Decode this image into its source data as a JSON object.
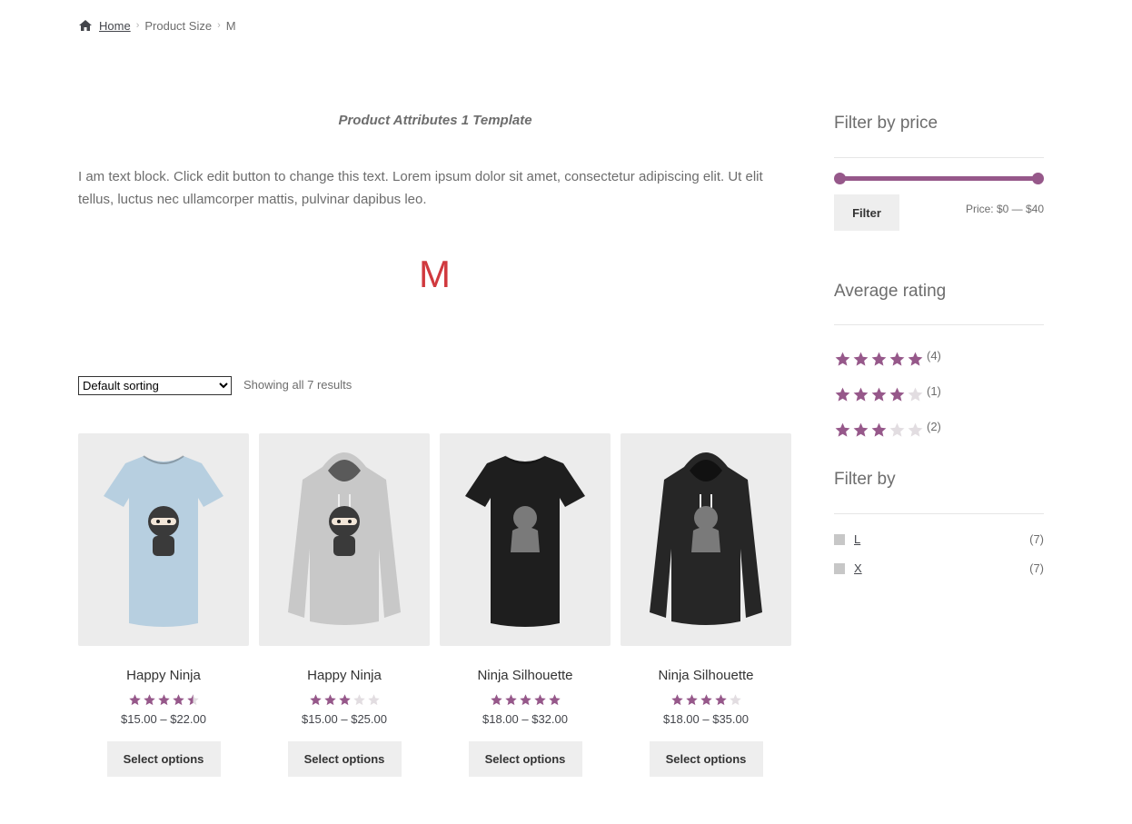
{
  "breadcrumb": {
    "home": "Home",
    "separator": "›",
    "level1": "Product Size",
    "level2": "M"
  },
  "template_title": "Product Attributes 1 Template",
  "text_block": "I am text block. Click edit button to change this text. Lorem ipsum dolor sit amet, consectetur adipiscing elit. Ut elit tellus, luctus nec ullamcorper mattis, pulvinar dapibus leo.",
  "size_heading": "M",
  "ordering": {
    "selected": "Default sorting"
  },
  "result_count": "Showing all 7 results",
  "products": [
    {
      "title": "Happy Ninja",
      "rating": 4.5,
      "price": "$15.00 – $22.00",
      "button": "Select options",
      "garment": "tshirt",
      "color": "#b7cfe0",
      "figure": "ninja"
    },
    {
      "title": "Happy Ninja",
      "rating": 3,
      "price": "$15.00 – $25.00",
      "button": "Select options",
      "garment": "hoodie",
      "color": "#c8c8c8",
      "figure": "ninja"
    },
    {
      "title": "Ninja Silhouette",
      "rating": 5,
      "price": "$18.00 – $32.00",
      "button": "Select options",
      "garment": "tshirt",
      "color": "#1e1e1e",
      "figure": "silhouette"
    },
    {
      "title": "Ninja Silhouette",
      "rating": 4,
      "price": "$18.00 – $35.00",
      "button": "Select options",
      "garment": "hoodie",
      "color": "#262626",
      "figure": "silhouette"
    }
  ],
  "sidebar": {
    "price_filter": {
      "title": "Filter by price",
      "button": "Filter",
      "price_label": "Price: $0 — $40",
      "min_fraction": 0,
      "max_fraction": 1
    },
    "average_rating": {
      "title": "Average rating",
      "items": [
        {
          "stars": 5,
          "count": "(4)"
        },
        {
          "stars": 4,
          "count": "(1)"
        },
        {
          "stars": 3,
          "count": "(2)"
        }
      ]
    },
    "filter_by": {
      "title": "Filter by",
      "items": [
        {
          "label": "L",
          "count": "(7)"
        },
        {
          "label": "X",
          "count": "(7)"
        }
      ]
    }
  },
  "colors": {
    "accent": "#96588a",
    "heading_red": "#d0393e",
    "star_empty": "#e2dde1"
  }
}
